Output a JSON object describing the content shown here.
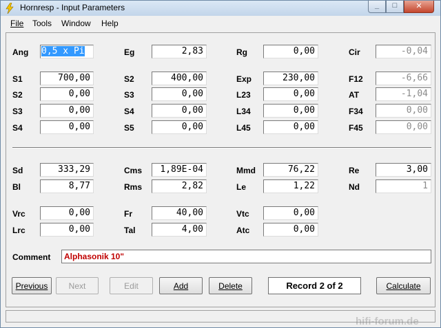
{
  "window": {
    "title": "Hornresp - Input Parameters"
  },
  "menu": [
    "File",
    "Tools",
    "Window",
    "Help"
  ],
  "row1": [
    {
      "label": "Ang",
      "value": "0,5 x Pi"
    },
    {
      "label": "Eg",
      "value": "2,83"
    },
    {
      "label": "Rg",
      "value": "0,00"
    },
    {
      "label": "Cir",
      "value": "-0,04"
    }
  ],
  "grid1": [
    [
      {
        "label": "S1",
        "value": "700,00"
      },
      {
        "label": "S2",
        "value": "400,00"
      },
      {
        "label": "Exp",
        "value": "230,00"
      },
      {
        "label": "F12",
        "value": "-6,66"
      }
    ],
    [
      {
        "label": "S2",
        "value": "0,00"
      },
      {
        "label": "S3",
        "value": "0,00"
      },
      {
        "label": "L23",
        "value": "0,00"
      },
      {
        "label": "AT",
        "value": "-1,04"
      }
    ],
    [
      {
        "label": "S3",
        "value": "0,00"
      },
      {
        "label": "S4",
        "value": "0,00"
      },
      {
        "label": "L34",
        "value": "0,00"
      },
      {
        "label": "F34",
        "value": "0,00"
      }
    ],
    [
      {
        "label": "S4",
        "value": "0,00"
      },
      {
        "label": "S5",
        "value": "0,00"
      },
      {
        "label": "L45",
        "value": "0,00"
      },
      {
        "label": "F45",
        "value": "0,00"
      }
    ]
  ],
  "grid2": [
    [
      {
        "label": "Sd",
        "value": "333,29"
      },
      {
        "label": "Cms",
        "value": "1,89E-04"
      },
      {
        "label": "Mmd",
        "value": "76,22"
      },
      {
        "label": "Re",
        "value": "3,00"
      }
    ],
    [
      {
        "label": "Bl",
        "value": "8,77"
      },
      {
        "label": "Rms",
        "value": "2,82"
      },
      {
        "label": "Le",
        "value": "1,22"
      },
      {
        "label": "Nd",
        "value": "1"
      }
    ]
  ],
  "grid3": [
    [
      {
        "label": "Vrc",
        "value": "0,00"
      },
      {
        "label": "Fr",
        "value": "40,00"
      },
      {
        "label": "Vtc",
        "value": "0,00"
      }
    ],
    [
      {
        "label": "Lrc",
        "value": "0,00"
      },
      {
        "label": "Tal",
        "value": "4,00"
      },
      {
        "label": "Atc",
        "value": "0,00"
      }
    ]
  ],
  "comment": {
    "label": "Comment",
    "value": "Alphasonik 10\""
  },
  "buttons": {
    "previous": "Previous",
    "next": "Next",
    "edit": "Edit",
    "add": "Add",
    "delete": "Delete",
    "record": "Record 2 of 2",
    "calculate": "Calculate"
  },
  "icons": {
    "app": "lightning-bolt-icon"
  },
  "watermark": "hifi-forum.de",
  "colors": {
    "comment_text": "#c00000",
    "selection": "#3399ff"
  }
}
